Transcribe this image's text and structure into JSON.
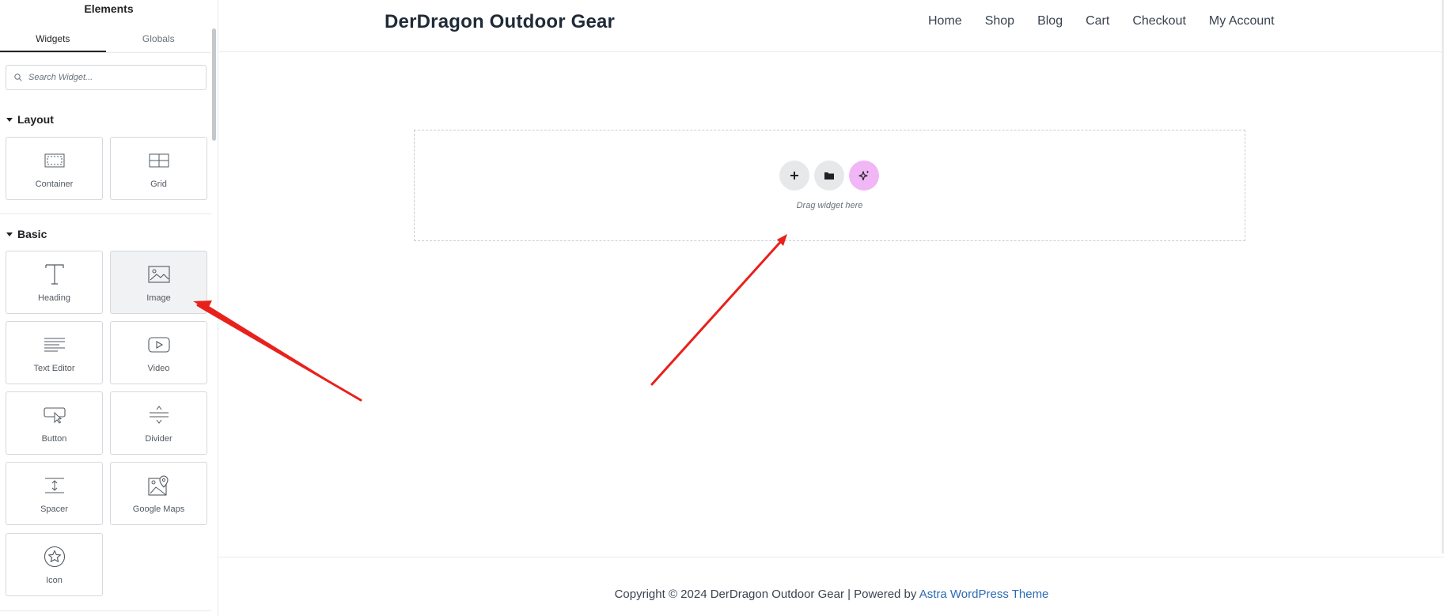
{
  "panel": {
    "title": "Elements",
    "tabs": [
      {
        "label": "Widgets",
        "active": true
      },
      {
        "label": "Globals",
        "active": false
      }
    ],
    "search": {
      "placeholder": "Search Widget..."
    },
    "sections": [
      {
        "title": "Layout",
        "widgets": [
          {
            "label": "Container",
            "icon": "container-icon"
          },
          {
            "label": "Grid",
            "icon": "grid-icon"
          }
        ]
      },
      {
        "title": "Basic",
        "widgets": [
          {
            "label": "Heading",
            "icon": "heading-icon"
          },
          {
            "label": "Image",
            "icon": "image-icon"
          },
          {
            "label": "Text Editor",
            "icon": "text-editor-icon"
          },
          {
            "label": "Video",
            "icon": "video-icon"
          },
          {
            "label": "Button",
            "icon": "button-icon"
          },
          {
            "label": "Divider",
            "icon": "divider-icon"
          },
          {
            "label": "Spacer",
            "icon": "spacer-icon"
          },
          {
            "label": "Google Maps",
            "icon": "google-maps-icon"
          },
          {
            "label": "Icon",
            "icon": "star-icon"
          }
        ]
      }
    ]
  },
  "site": {
    "title": "DerDragon Outdoor Gear",
    "nav": [
      "Home",
      "Shop",
      "Blog",
      "Cart",
      "Checkout",
      "My Account"
    ]
  },
  "dropzone": {
    "label": "Drag widget here",
    "buttons": [
      "add-section-icon",
      "template-library-icon",
      "ai-sparkle-icon"
    ]
  },
  "footer": {
    "text": "Copyright © 2024 DerDragon Outdoor Gear | Powered by ",
    "link": "Astra WordPress Theme"
  },
  "colors": {
    "accent_ai": "#f0b6f5",
    "annotation_arrow": "#e8211c",
    "footer_link": "#2a6bb3"
  }
}
